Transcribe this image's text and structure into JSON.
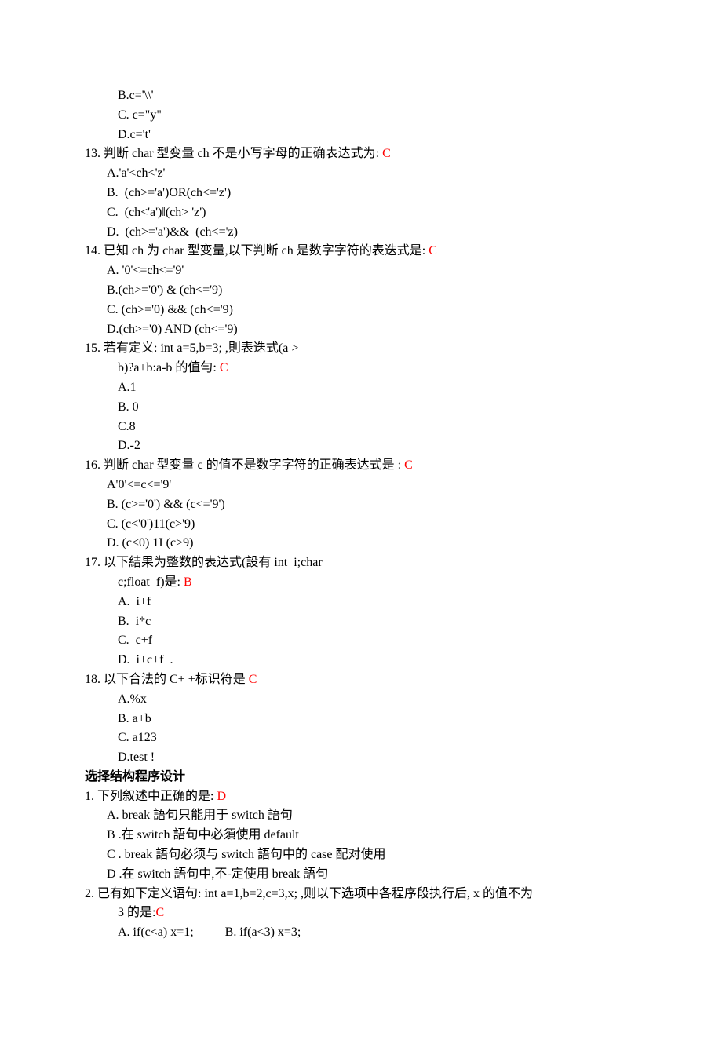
{
  "lines": [
    {
      "cls": "indent-opt2",
      "text": "B.c='\\\\'"
    },
    {
      "cls": "indent-opt2",
      "text": "C. c=\"y\""
    },
    {
      "cls": "indent-opt2",
      "text": "D.c='t'"
    },
    {
      "cls": "q-line",
      "text": "13. 判断 char 型变量 ch 不是小写字母的正确表达式为: ",
      "ans": "C"
    },
    {
      "cls": "indent-opt",
      "text": "A.'a'<ch<'z'"
    },
    {
      "cls": "indent-opt",
      "text": "B.  (ch>='a')OR(ch<='z')"
    },
    {
      "cls": "indent-opt",
      "text": "C.  (ch<'a')‖(ch> 'z')"
    },
    {
      "cls": "indent-opt",
      "text": "D.  (ch>='a')&&  (ch<='z)"
    },
    {
      "cls": "q-line",
      "text": "14. 已知 ch 为 char 型变量,以下判断 ch 是数字字符的表迭式是: ",
      "ans": "C"
    },
    {
      "cls": "indent-opt",
      "text": "A. '0'<=ch<='9'"
    },
    {
      "cls": "indent-opt",
      "text": "B.(ch>='0') & (ch<='9)"
    },
    {
      "cls": "indent-opt",
      "text": "C. (ch>='0) && (ch<='9)"
    },
    {
      "cls": "indent-opt",
      "text": "D.(ch>='0) AND (ch<='9)"
    },
    {
      "cls": "q-line",
      "text": "15. 若有定义: int a=5,b=3; ,則表迭式(a >"
    },
    {
      "cls": "indent-opt2",
      "text": "b)?a+b:a-b 的值勻: ",
      "ans": "C"
    },
    {
      "cls": "indent-opt2",
      "text": "A.1"
    },
    {
      "cls": "indent-opt2",
      "text": "B. 0"
    },
    {
      "cls": "indent-opt2",
      "text": "C.8"
    },
    {
      "cls": "indent-opt2",
      "text": "D.-2"
    },
    {
      "cls": "q-line",
      "text": "16. 判断 char 型变量 c 的值不是数字字符的正确表达式是 : ",
      "ans": "C"
    },
    {
      "cls": "indent-opt",
      "text": "A'0'<=c<='9'"
    },
    {
      "cls": "indent-opt",
      "text": "B. (c>='0') && (c<='9')"
    },
    {
      "cls": "indent-opt",
      "text": "C. (c<'0')11(c>'9)"
    },
    {
      "cls": "indent-opt",
      "text": "D. (c<0) 1I (c>9)"
    },
    {
      "cls": "q-line",
      "text": "17. 以下結果为整数的表达式(設有 int  i;char"
    },
    {
      "cls": "indent-opt2",
      "text": "c;float  f)是: ",
      "ans": "B"
    },
    {
      "cls": "indent-opt2",
      "text": "A.  i+f"
    },
    {
      "cls": "indent-opt2",
      "text": "B.  i*c"
    },
    {
      "cls": "indent-opt2",
      "text": "C.  c+f"
    },
    {
      "cls": "indent-opt2",
      "text": "D.  i+c+f  ."
    },
    {
      "cls": "q-line",
      "text": "18. 以下合法的 C+ +标识符是 ",
      "ans": "C"
    },
    {
      "cls": "indent-opt2",
      "text": "A.%x"
    },
    {
      "cls": "indent-opt2",
      "text": "B. a+b"
    },
    {
      "cls": "indent-opt2",
      "text": "C. a123"
    },
    {
      "cls": "indent-opt2",
      "text": "D.test !"
    },
    {
      "cls": "bold",
      "text": "选择结构程序设计"
    },
    {
      "cls": "q-line",
      "text": "1. 下列叙述中正确的是: ",
      "ans": "D"
    },
    {
      "cls": "indent-opt",
      "text": "A. break 語句只能用于 switch 語句"
    },
    {
      "cls": "indent-opt",
      "text": "B .在 switch 語句中必須使用 default"
    },
    {
      "cls": "indent-opt",
      "text": "C . break 語句必须与 switch 語句中的 case 配对使用"
    },
    {
      "cls": "indent-opt",
      "text": "D .在 switch 語句中,不-定使用 break 語句"
    },
    {
      "cls": "q-line",
      "text": "2. 已有如下定义语句: int a=1,b=2,c=3,x; ,则以下选项中各程序段执行后, x 的值不为"
    },
    {
      "cls": "indent-opt2",
      "text": "3 的是:",
      "ans": "C"
    },
    {
      "cls": "indent-opt2",
      "text": "A. if(c<a) x=1;          B. if(a<3) x=3;"
    }
  ]
}
